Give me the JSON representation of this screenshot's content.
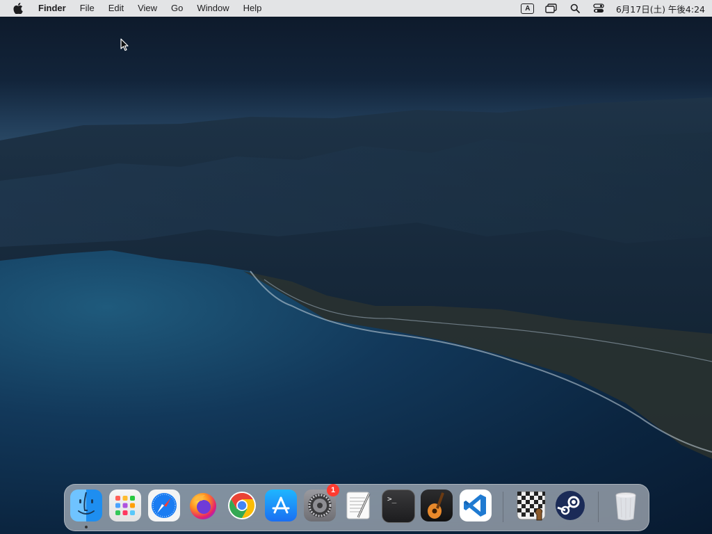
{
  "menubar": {
    "apple_icon": "apple-logo-icon",
    "app_name": "Finder",
    "menus": [
      "File",
      "Edit",
      "View",
      "Go",
      "Window",
      "Help"
    ],
    "status": {
      "input_source": "A",
      "clock": "6月17日(土) 午後4:24"
    }
  },
  "dock": {
    "apps": [
      {
        "name": "finder",
        "running": true
      },
      {
        "name": "launchpad"
      },
      {
        "name": "safari"
      },
      {
        "name": "firefox"
      },
      {
        "name": "chrome"
      },
      {
        "name": "app-store"
      },
      {
        "name": "system-preferences",
        "badge": "1"
      },
      {
        "name": "textedit"
      },
      {
        "name": "terminal",
        "prompt": ">_"
      },
      {
        "name": "garageband"
      },
      {
        "name": "vscode"
      },
      {
        "name": "chess"
      },
      {
        "name": "steam"
      },
      {
        "name": "trash"
      }
    ],
    "colors": {
      "badge": "#ff3b30",
      "finder_blue": "#1e8ef0",
      "safari_blue": "#1a7cf2",
      "appstore_blue": "#1a8cf5",
      "vscode_blue": "#1f7ad1",
      "steam_blue": "#1b2b57"
    }
  }
}
